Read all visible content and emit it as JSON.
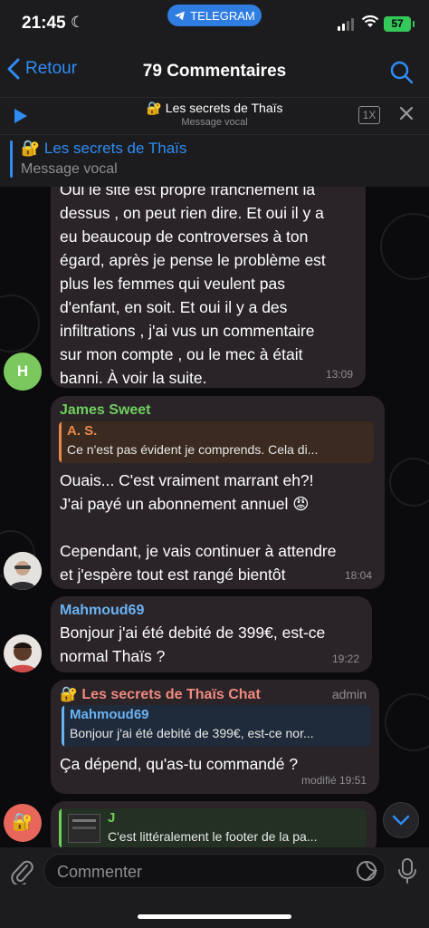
{
  "status": {
    "time": "21:45",
    "app_pill": "TELEGRAM",
    "battery": "57"
  },
  "nav": {
    "back_label": "Retour",
    "title": "79 Commentaires"
  },
  "player": {
    "title": "🔐 Les secrets de Thaïs",
    "subtitle": "Message vocal",
    "speed": "1X"
  },
  "pinned": {
    "title": "🔐 Les secrets de Thaïs",
    "subtitle": "Message vocal"
  },
  "messages": [
    {
      "avatar_letter": "H",
      "text": "Oui le site est propre franchement la\ndessus , on peut rien dire. Et oui il y a\neu beaucoup de controverses à ton\négard, après je pense le problème est\nplus les femmes qui veulent pas\nd'enfant, en soit. Et oui il y a des\ninfiltrations , j'ai vus un commentaire\nsur mon compte , ou le mec à était\nbanni. À voir la suite.",
      "time": "13:09"
    },
    {
      "author": "James Sweet",
      "author_color": "#6fcf5e",
      "reply": {
        "name": "A. S.",
        "text": "Ce n'est pas évident je comprends. Cela di...",
        "color": "#e8894a"
      },
      "text": "Ouais... C'est vraiment marrant eh?!\nJ'ai payé un abonnement annuel 😡\n\nCependant, je vais continuer à attendre\net j'espère tout est rangé bientôt",
      "time": "18:04"
    },
    {
      "author": "Mahmoud69",
      "author_color": "#6ab3f3",
      "text": "Bonjour j'ai été debité de 399€, est-ce\nnormal Thaïs ?",
      "time": "19:22"
    },
    {
      "author": "🔐 Les secrets de Thaïs Chat",
      "author_color": "#f08a7e",
      "badge": "admin",
      "reply": {
        "name": "Mahmoud69",
        "text": "Bonjour j'ai été debité de 399€, est-ce nor...",
        "color": "#6ab3f3"
      },
      "text": "Ça dépend, qu'as-tu commandé ?",
      "time": "modifié 19:51"
    },
    {
      "reply": {
        "name": "J",
        "text": "C'est littéralement le footer de la pa...",
        "color": "#6fcf5e"
      }
    }
  ],
  "composer": {
    "placeholder": "Commenter"
  },
  "colors": {
    "accent": "#2f8cf5",
    "bubble": "#2a2428"
  }
}
